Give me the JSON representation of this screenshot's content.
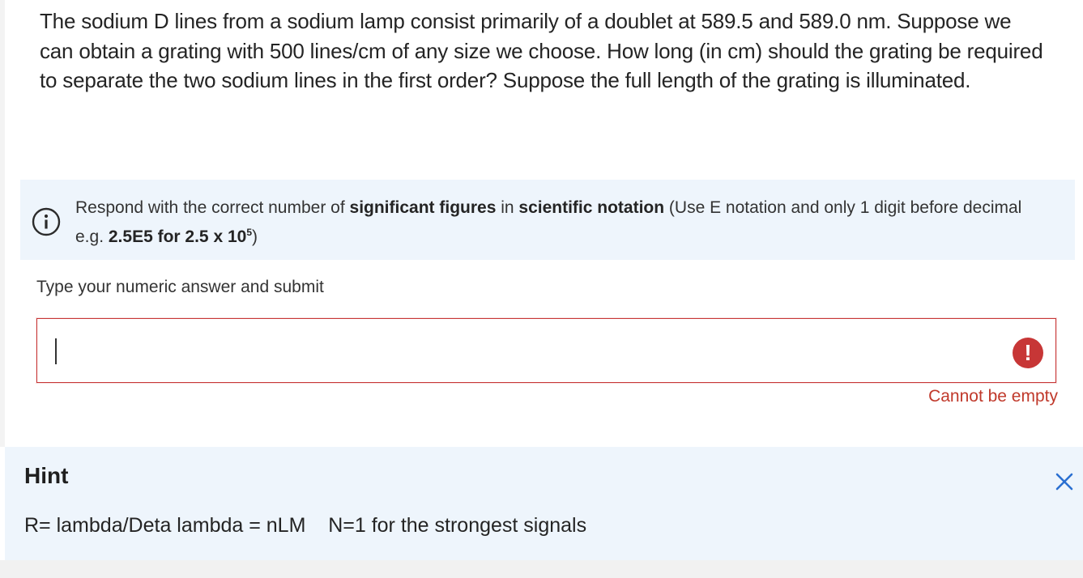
{
  "question": {
    "text": "The sodium D lines from a sodium lamp consist primarily of a doublet at 589.5 and 589.0 nm. Suppose we can obtain a grating with 500 lines/cm of any size we choose. How long (in cm) should the grating be required to separate the two sodium lines in the first order? Suppose the full length of the grating is illuminated."
  },
  "instructions": {
    "icon": "info-icon",
    "part1": "Respond with the correct number of ",
    "bold1": "significant figures",
    "part2": " in ",
    "bold2": "scientific notation",
    "part3": " (Use E notation and only 1 digit before decimal e.g. ",
    "bold3": "2.5E5 for 2.5 x 10",
    "bold3_sup": "5",
    "part4": ")"
  },
  "answer": {
    "label": "Type your numeric answer and submit",
    "value": "",
    "placeholder": "",
    "error_icon": "!",
    "error_message": "Cannot be empty"
  },
  "hint": {
    "title": "Hint",
    "body": "R= lambda/Deta lambda = nLM    N=1 for the strongest signals",
    "close_icon": "close-icon"
  },
  "colors": {
    "error": "#c73636",
    "panel_bg": "#eef5fc",
    "close_icon": "#2a6fd1"
  }
}
